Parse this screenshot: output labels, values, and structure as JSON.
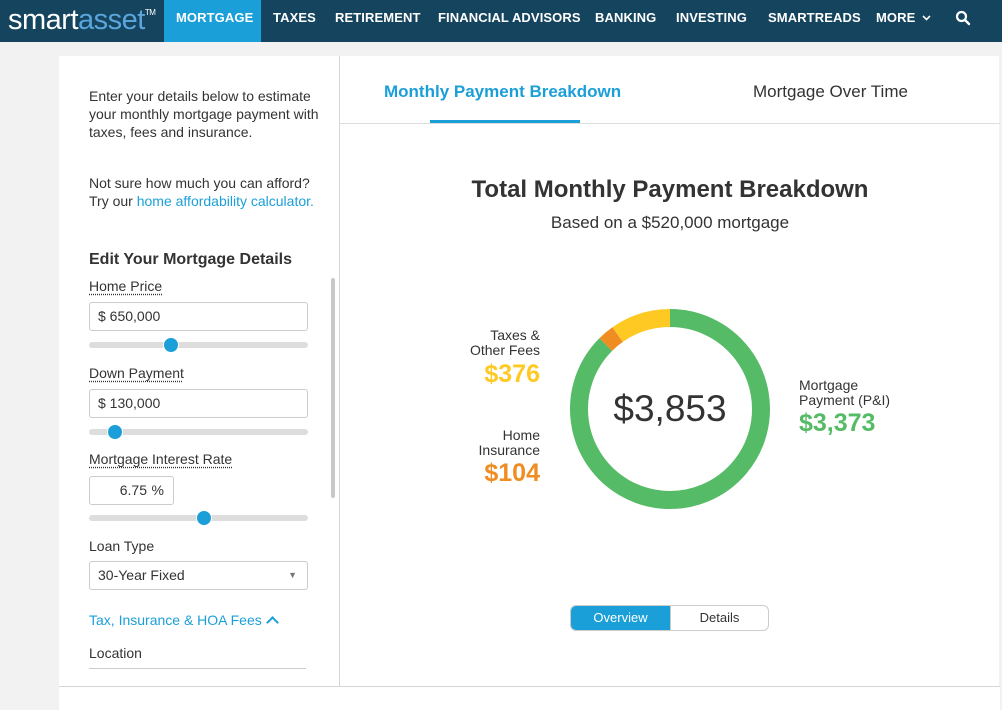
{
  "brand": {
    "smart": "smart",
    "asset": "asset",
    "tm": "TM"
  },
  "nav": {
    "items": [
      "MORTGAGE",
      "TAXES",
      "RETIREMENT",
      "FINANCIAL ADVISORS",
      "BANKING",
      "INVESTING",
      "SMARTREADS",
      "MORE"
    ],
    "active": "MORTGAGE"
  },
  "sidebar": {
    "intro": "Enter your details below to estimate your monthly mortgage payment with taxes, fees and insurance.",
    "afford_prefix": "Not sure how much you can afford? Try our ",
    "afford_link": "home affordability calculator.",
    "section_title": "Edit Your Mortgage Details",
    "home_price": {
      "label": "Home Price",
      "value": "$ 650,000",
      "slider_pct": 0.375
    },
    "down_payment": {
      "label": "Down Payment",
      "value": "$ 130,000",
      "slider_pct": 0.118
    },
    "rate": {
      "label": "Mortgage Interest Rate",
      "value": "6.75",
      "unit": "%",
      "slider_pct": 0.525
    },
    "loan_type": {
      "label": "Loan Type",
      "value": "30-Year Fixed"
    },
    "tax_toggle": "Tax, Insurance & HOA Fees",
    "location": {
      "label": "Location"
    }
  },
  "main": {
    "tabs": [
      "Monthly Payment Breakdown",
      "Mortgage Over Time"
    ],
    "title": "Total Monthly Payment Breakdown",
    "subtitle": "Based on a $520,000 mortgage",
    "total": "$3,853",
    "legend": {
      "taxes": {
        "label1": "Taxes &",
        "label2": "Other Fees",
        "value": "$376",
        "color": "#fec923"
      },
      "insurance": {
        "label1": "Home",
        "label2": "Insurance",
        "value": "$104",
        "color": "#ef8d22"
      },
      "mortgage": {
        "label1": "Mortgage",
        "label2": "Payment (P&I)",
        "value": "$3,373",
        "color": "#55bb66"
      }
    },
    "toggle": {
      "overview": "Overview",
      "details": "Details"
    }
  },
  "chart_data": {
    "type": "pie",
    "title": "Total Monthly Payment Breakdown",
    "subtitle": "Based on a $520,000 mortgage",
    "center_label": "$3,853",
    "categories": [
      "Mortgage Payment (P&I)",
      "Home Insurance",
      "Taxes & Other Fees"
    ],
    "values": [
      3373,
      104,
      376
    ],
    "colors": [
      "#55bb66",
      "#ef8d22",
      "#fec923"
    ]
  }
}
